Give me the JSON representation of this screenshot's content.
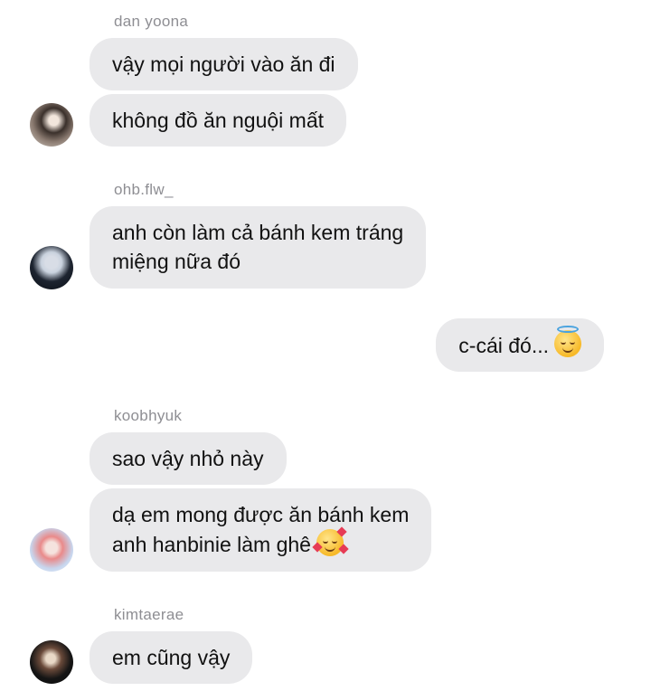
{
  "conversation": [
    {
      "sender": "dan yoona",
      "messages": [
        "vậy mọi người vào ăn đi",
        "không đồ ăn nguội mất"
      ]
    },
    {
      "sender": "ohb.flw_",
      "messages": [
        "anh còn làm cả bánh kem tráng",
        "miệng nữa đó"
      ]
    },
    {
      "sender": "me",
      "messages": [
        "c-cái đó..."
      ],
      "emoji": "smiling-face-with-halo"
    },
    {
      "sender": "koobhyuk",
      "messages": [
        "sao vậy nhỏ này",
        "dạ em mong được ăn bánh kem",
        "anh hanbinie làm ghê"
      ],
      "emoji": "smiling-face-with-hearts"
    },
    {
      "sender": "kimtaerae",
      "messages": [
        "em cũng vậy"
      ]
    }
  ],
  "colors": {
    "bubble_bg": "#e9e9eb",
    "name_text": "#8e8e93",
    "message_text": "#111111"
  }
}
